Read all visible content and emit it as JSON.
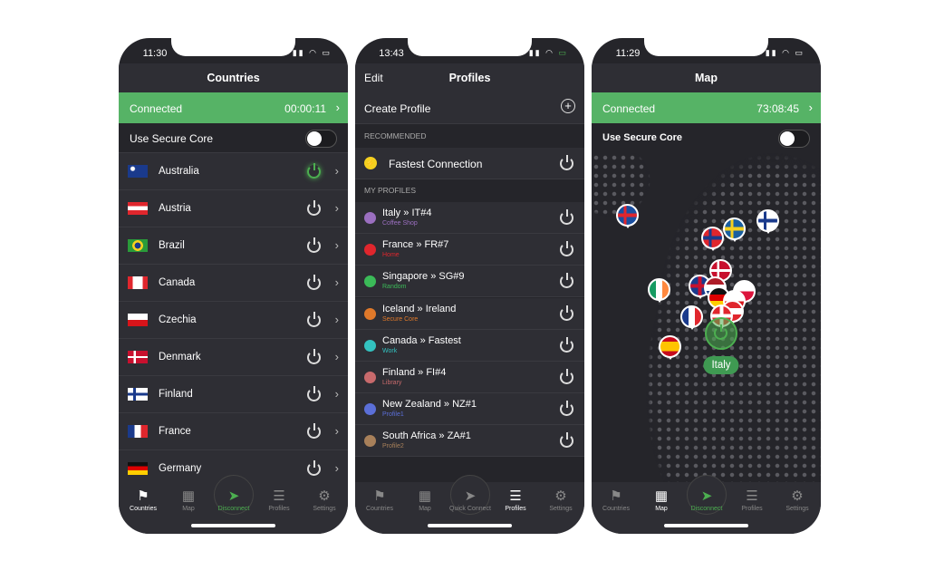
{
  "phone1": {
    "time": "11:30",
    "title": "Countries",
    "connected": "Connected",
    "timer": "00:00:11",
    "secure_core": "Use Secure Core",
    "countries": [
      {
        "name": "Australia",
        "flag": "au",
        "active": true
      },
      {
        "name": "Austria",
        "flag": "at"
      },
      {
        "name": "Brazil",
        "flag": "br"
      },
      {
        "name": "Canada",
        "flag": "ca"
      },
      {
        "name": "Czechia",
        "flag": "cz"
      },
      {
        "name": "Denmark",
        "flag": "dk"
      },
      {
        "name": "Finland",
        "flag": "fi"
      },
      {
        "name": "France",
        "flag": "fr"
      },
      {
        "name": "Germany",
        "flag": "de"
      }
    ],
    "tabs": [
      "Countries",
      "Map",
      "Disconnect",
      "Profiles",
      "Settings"
    ],
    "active_tab": "Countries"
  },
  "phone2": {
    "time": "13:43",
    "edit": "Edit",
    "title": "Profiles",
    "create_profile": "Create Profile",
    "recommended": "RECOMMENDED",
    "fastest": "Fastest Connection",
    "my_profiles": "MY PROFILES",
    "profiles": [
      {
        "from": "Italy",
        "to": "IT#4",
        "sub": "Coffee Shop",
        "color": "#9b6fc0"
      },
      {
        "from": "France",
        "to": "FR#7",
        "sub": "Home",
        "color": "#e0262d"
      },
      {
        "from": "Singapore",
        "to": "SG#9",
        "sub": "Random",
        "color": "#3bba58"
      },
      {
        "from": "Iceland",
        "to": "Ireland",
        "sub": "Secure Core",
        "color": "#e0792a"
      },
      {
        "from": "Canada",
        "to": "Fastest",
        "sub": "Work",
        "color": "#33c2c0"
      },
      {
        "from": "Finland",
        "to": "FI#4",
        "sub": "Library",
        "color": "#c86a6c"
      },
      {
        "from": "New Zealand",
        "to": "NZ#1",
        "sub": "Profile1",
        "color": "#5b6fd8"
      },
      {
        "from": "South Africa",
        "to": "ZA#1",
        "sub": "Profile2",
        "color": "#a8805a"
      }
    ],
    "tabs": [
      "Countries",
      "Map",
      "Quick Connect",
      "Profiles",
      "Settings"
    ],
    "active_tab": "Profiles"
  },
  "phone3": {
    "time": "11:29",
    "title": "Map",
    "connected": "Connected",
    "timer": "73:08:45",
    "secure_core": "Use Secure Core",
    "selected_country": "Italy",
    "pins": [
      "is",
      "no",
      "se",
      "fi",
      "dk",
      "ie",
      "gb",
      "nl",
      "pl",
      "de",
      "cz",
      "at",
      "ch",
      "fr",
      "es"
    ],
    "tabs": [
      "Countries",
      "Map",
      "Disconnect",
      "Profiles",
      "Settings"
    ],
    "active_tab": "Map"
  },
  "colors": {
    "accent": "#56b366",
    "background": "#25252a"
  }
}
